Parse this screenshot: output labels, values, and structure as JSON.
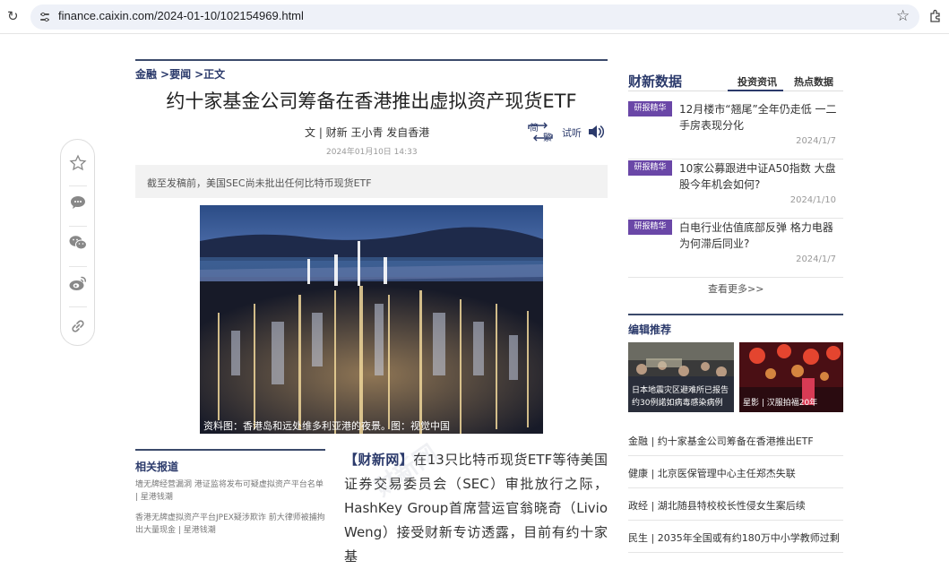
{
  "browser": {
    "url": "finance.caixin.com/2024-01-10/102154969.html"
  },
  "breadcrumb": [
    "金融",
    ">要闻",
    ">正文"
  ],
  "article": {
    "title": "约十家基金公司筹备在香港推出虚拟资产现货ETF",
    "byline": "文 | 财新 王小青 发自香港",
    "date": "2024年01月10日 14:33",
    "jian_label_top": "简",
    "jian_label_bottom": "繁",
    "listen_label": "试听",
    "summary": "截至发稿前，美国SEC尚未批出任何比特币现货ETF",
    "photo_caption": "资料图：香港岛和远处维多利亚港的夜景。图：视觉中国",
    "body_lead": "【财新网】",
    "body_text": "在13只比特币现货ETF等待美国证券交易委员会（SEC）审批放行之际，HashKey Group首席营运官翁晓奇（Livio Weng）接受财新专访透露，目前有约十家基",
    "watermark": "财新网"
  },
  "related": {
    "title": "相关报道",
    "items": [
      "墙无牌经营漏洞 港证监将发布可疑虚拟资产平台名单 | 星港钱潮",
      "香港无牌虚拟资产平台JPEX疑涉欺诈 前大律师被捕拘出大量现金 | 星港钱潮"
    ]
  },
  "sidebar": {
    "heading": "财新数据",
    "tabs": [
      "投资资讯",
      "热点数据"
    ],
    "reports": [
      {
        "badge": "研报精华",
        "title": "12月楼市“翘尾”全年仍走低 一二手房表现分化",
        "date": "2024/1/7"
      },
      {
        "badge": "研报精华",
        "title": "10家公募跟进中证A50指数 大盘股今年机会如何?",
        "date": "2024/1/10"
      },
      {
        "badge": "研报精华",
        "title": "白电行业估值底部反弹 格力电器为何滞后同业?",
        "date": "2024/1/7"
      }
    ],
    "more": "查看更多>>",
    "editor_title": "编辑推荐",
    "thumbs": [
      {
        "caption": "日本地震灾区避难所已报告约30例諾如病毒感染病例"
      },
      {
        "caption": "星影 | 汉服拍福20年"
      }
    ],
    "news": [
      "金融 | 约十家基金公司筹备在香港推出ETF",
      "健康 | 北京医保管理中心主任郑杰失联",
      "政经 | 湖北随县特校校长性侵女生案后续",
      "民生 | 2035年全国或有约180万中小学教师过剩"
    ]
  },
  "colors": {
    "brand": "#2b3a6b",
    "badge": "#6a47a7"
  }
}
